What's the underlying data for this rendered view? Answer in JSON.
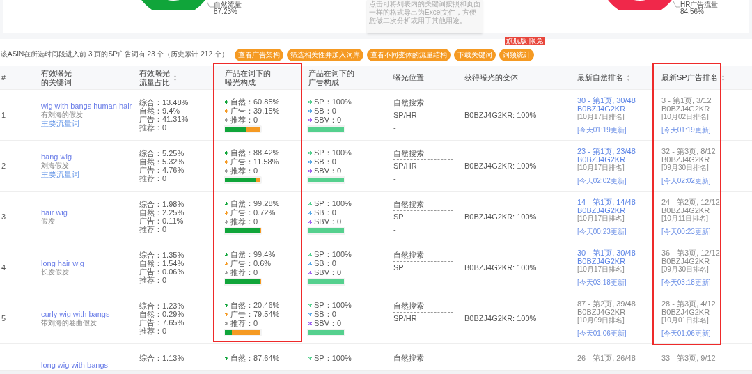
{
  "summary": {
    "charts": [
      {
        "label": "自然流量",
        "value": "87.23%",
        "color": "#10a53a"
      },
      {
        "label": "HR广告流量",
        "value": "84.56%",
        "color": "#f0284a"
      }
    ],
    "tooltip": "点击可将列表内的关键词按照和页面一样的格式导出为Excel文件，方便您做二次分析或用于其他用途。"
  },
  "toolbar": {
    "text": "该ASIN在所选时间段进入前 3 页的SP广告词有 23 个（历史累计 212 个）",
    "buttons": [
      {
        "label": "查看广告架构"
      },
      {
        "label": "筛选相关性并加入词库"
      },
      {
        "label": "查看不同变体的流量结构"
      },
      {
        "label": "下载关键词"
      },
      {
        "label": "词频统计",
        "badge": "旗舰版·限免"
      }
    ]
  },
  "table": {
    "columns": [
      {
        "lines": [
          "#"
        ],
        "kind": "plain"
      },
      {
        "lines": [
          "有效曝光",
          "的关键词"
        ],
        "kind": "plain"
      },
      {
        "lines": [
          "有效曝光",
          "流量占比"
        ],
        "kind": "sortable"
      },
      {
        "lines": [
          "产品在词下的",
          "曝光构成"
        ],
        "kind": "plain"
      },
      {
        "lines": [
          "产品在词下的",
          "广告构成"
        ],
        "kind": "plain"
      },
      {
        "lines": [
          "曝光位置"
        ],
        "kind": "plain"
      },
      {
        "lines": [
          "获得曝光的变体"
        ],
        "kind": "plain"
      },
      {
        "lines": [
          "最新自然排名"
        ],
        "kind": "sortable"
      },
      {
        "lines": [
          "最新SP广告排名"
        ],
        "kind": "sortable"
      }
    ],
    "rows": [
      {
        "index": "1",
        "keyword": "wig with bangs human hair",
        "translation": "有刘海的假发",
        "tag": "主要流量词",
        "share": [
          "综合：13.48%",
          "自然：9.4%",
          "广告：41.31%",
          "推荐：0"
        ],
        "exposure": {
          "items": [
            {
              "text": "自然：60.85%",
              "color": "#10a53a"
            },
            {
              "text": "广告：39.15%",
              "color": "#f59a23"
            },
            {
              "text": "推荐：0",
              "color": "#999999"
            }
          ],
          "bar": [
            {
              "level": 0.6085,
              "color": "#10a53a"
            },
            {
              "level": 0.3915,
              "color": "#f59a23"
            }
          ]
        },
        "ads": {
          "items": [
            {
              "text": "SP：100%",
              "color": "#55d08e"
            },
            {
              "text": "SB：0",
              "color": "#5aa9e6"
            },
            {
              "text": "SBV：0",
              "color": "#a064f0"
            }
          ],
          "bar": [
            {
              "level": 1,
              "color": "#55d08e"
            }
          ]
        },
        "position": [
          "自然搜索",
          "SP/HR",
          "-"
        ],
        "variant": "B0BZJ4G2KR: 100%",
        "natural_rank": {
          "rank": "30 - 第1页, 30/48",
          "asin": "B0BZJ4G2KR",
          "date": "[10月17日排名]",
          "updated": "[今天01:19更新]",
          "linked": true
        },
        "sp_rank": {
          "rank": "3 - 第1页, 3/12",
          "asin": "B0BZJ4G2KR",
          "date": "[10月02日排名]",
          "updated": "[今天01:19更新]",
          "linked": false
        }
      },
      {
        "index": "2",
        "keyword": "bang wig",
        "translation": "刘海假发",
        "tag": "主要流量词",
        "share": [
          "综合：5.25%",
          "自然：5.32%",
          "广告：4.76%",
          "推荐：0"
        ],
        "exposure": {
          "items": [
            {
              "text": "自然：88.42%",
              "color": "#10a53a"
            },
            {
              "text": "广告：11.58%",
              "color": "#f59a23"
            },
            {
              "text": "推荐：0",
              "color": "#999999"
            }
          ],
          "bar": [
            {
              "level": 0.8842,
              "color": "#10a53a"
            },
            {
              "level": 0.1158,
              "color": "#f59a23"
            }
          ]
        },
        "ads": {
          "items": [
            {
              "text": "SP：100%",
              "color": "#55d08e"
            },
            {
              "text": "SB：0",
              "color": "#5aa9e6"
            },
            {
              "text": "SBV：0",
              "color": "#a064f0"
            }
          ],
          "bar": [
            {
              "level": 1,
              "color": "#55d08e"
            }
          ]
        },
        "position": [
          "自然搜索",
          "SP/HR",
          "-"
        ],
        "variant": "B0BZJ4G2KR: 100%",
        "natural_rank": {
          "rank": "23 - 第1页, 23/48",
          "asin": "B0BZJ4G2KR",
          "date": "[10月17日排名]",
          "updated": "[今天02:02更新]",
          "linked": true
        },
        "sp_rank": {
          "rank": "32 - 第3页, 8/12",
          "asin": "B0BZJ4G2KR",
          "date": "[09月30日排名]",
          "updated": "[今天02:02更新]",
          "linked": false
        }
      },
      {
        "index": "3",
        "keyword": "hair wig",
        "translation": "假发",
        "share": [
          "综合：1.98%",
          "自然：2.25%",
          "广告：0.11%",
          "推荐：0"
        ],
        "exposure": {
          "items": [
            {
              "text": "自然：99.28%",
              "color": "#10a53a"
            },
            {
              "text": "广告：0.72%",
              "color": "#f59a23"
            },
            {
              "text": "推荐：0",
              "color": "#999999"
            }
          ],
          "bar": [
            {
              "level": 0.9928,
              "color": "#10a53a"
            },
            {
              "level": 0.0072,
              "color": "#f59a23"
            }
          ]
        },
        "ads": {
          "items": [
            {
              "text": "SP：100%",
              "color": "#55d08e"
            },
            {
              "text": "SB：0",
              "color": "#5aa9e6"
            },
            {
              "text": "SBV：0",
              "color": "#a064f0"
            }
          ],
          "bar": [
            {
              "level": 1,
              "color": "#55d08e"
            }
          ]
        },
        "position": [
          "自然搜索",
          "SP",
          "-"
        ],
        "variant": "B0BZJ4G2KR: 100%",
        "natural_rank": {
          "rank": "14 - 第1页, 14/48",
          "asin": "B0BZJ4G2KR",
          "date": "[10月17日排名]",
          "updated": "[今天00:23更新]",
          "linked": true
        },
        "sp_rank": {
          "rank": "24 - 第2页, 12/12",
          "asin": "B0BZJ4G2KR",
          "date": "[10月11日排名]",
          "updated": "[今天00:23更新]",
          "linked": false
        }
      },
      {
        "index": "4",
        "keyword": "long hair wig",
        "translation": "长发假发",
        "share": [
          "综合：1.35%",
          "自然：1.54%",
          "广告：0.06%",
          "推荐：0"
        ],
        "exposure": {
          "items": [
            {
              "text": "自然：99.4%",
              "color": "#10a53a"
            },
            {
              "text": "广告：0.6%",
              "color": "#f59a23"
            },
            {
              "text": "推荐：0",
              "color": "#999999"
            }
          ],
          "bar": [
            {
              "level": 0.994,
              "color": "#10a53a"
            },
            {
              "level": 0.006,
              "color": "#f59a23"
            }
          ]
        },
        "ads": {
          "items": [
            {
              "text": "SP：100%",
              "color": "#55d08e"
            },
            {
              "text": "SB：0",
              "color": "#5aa9e6"
            },
            {
              "text": "SBV：0",
              "color": "#a064f0"
            }
          ],
          "bar": [
            {
              "level": 1,
              "color": "#55d08e"
            }
          ]
        },
        "position": [
          "自然搜索",
          "SP",
          "-"
        ],
        "variant": "B0BZJ4G2KR: 100%",
        "natural_rank": {
          "rank": "30 - 第1页, 30/48",
          "asin": "B0BZJ4G2KR",
          "date": "[10月17日排名]",
          "updated": "[今天03:18更新]",
          "linked": true
        },
        "sp_rank": {
          "rank": "36 - 第3页, 12/12",
          "asin": "B0BZJ4G2KR",
          "date": "[09月30日排名]",
          "updated": "[今天03:18更新]",
          "linked": false
        }
      },
      {
        "index": "5",
        "keyword": "curly wig with bangs",
        "translation": "带刘海的卷曲假发",
        "share": [
          "综合：1.23%",
          "自然：0.29%",
          "广告：7.65%",
          "推荐：0"
        ],
        "exposure": {
          "items": [
            {
              "text": "自然：20.46%",
              "color": "#10a53a"
            },
            {
              "text": "广告：79.54%",
              "color": "#f59a23"
            },
            {
              "text": "推荐：0",
              "color": "#999999"
            }
          ],
          "bar": [
            {
              "level": 0.2046,
              "color": "#10a53a"
            },
            {
              "level": 0.7954,
              "color": "#f59a23"
            }
          ]
        },
        "ads": {
          "items": [
            {
              "text": "SP：100%",
              "color": "#55d08e"
            },
            {
              "text": "SB：0",
              "color": "#5aa9e6"
            },
            {
              "text": "SBV：0",
              "color": "#a064f0"
            }
          ],
          "bar": [
            {
              "level": 1,
              "color": "#55d08e"
            }
          ]
        },
        "position": [
          "自然搜索",
          "SP/HR",
          "-"
        ],
        "variant": "B0BZJ4G2KR: 100%",
        "natural_rank": {
          "rank": "87 - 第2页, 39/48",
          "asin": "B0BZJ4G2KR",
          "date": "[10月09日排名]",
          "updated": "[今天01:06更新]",
          "linked": false
        },
        "sp_rank": {
          "rank": "28 - 第3页, 4/12",
          "asin": "B0BZJ4G2KR",
          "date": "[10月01日排名]",
          "updated": "[今天01:06更新]",
          "linked": false
        }
      },
      {
        "keyword": "long wig with bangs",
        "share": [
          "综合：1.13%"
        ],
        "exposure": {
          "items": [
            {
              "text": "自然：87.64%",
              "color": "#10a53a"
            }
          ]
        },
        "ads": {
          "items": [
            {
              "text": "SP：100%",
              "color": "#55d08e"
            }
          ]
        },
        "position": [
          "自然搜索"
        ],
        "natural_rank": {
          "rank": "26 - 第1页, 26/48",
          "linked": false
        },
        "sp_rank": {
          "rank": "33 - 第3页, 9/12",
          "linked": false
        }
      }
    ]
  }
}
